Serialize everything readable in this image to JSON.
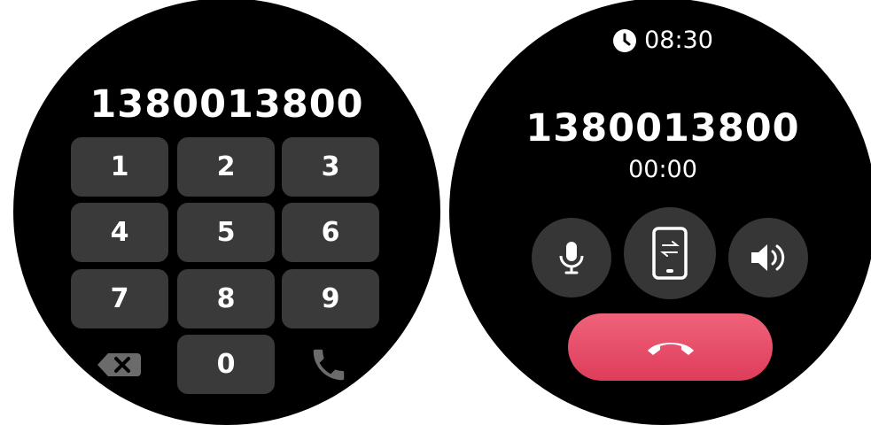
{
  "dialer": {
    "number": "1380013800",
    "keys": [
      "1",
      "2",
      "3",
      "4",
      "5",
      "6",
      "7",
      "8",
      "9",
      "0"
    ]
  },
  "call": {
    "clock_time": "08:30",
    "number": "1380013800",
    "timer": "00:00"
  },
  "icons": {
    "backspace": "backspace-icon",
    "dial": "phone-icon",
    "clock": "clock-icon",
    "mute": "microphone-icon",
    "transfer": "phone-transfer-icon",
    "speaker": "speaker-icon",
    "end_call": "hang-up-icon"
  },
  "colors": {
    "screen_bg": "#000000",
    "key_bg": "#3a3a3a",
    "end_call": "#e94d68"
  }
}
